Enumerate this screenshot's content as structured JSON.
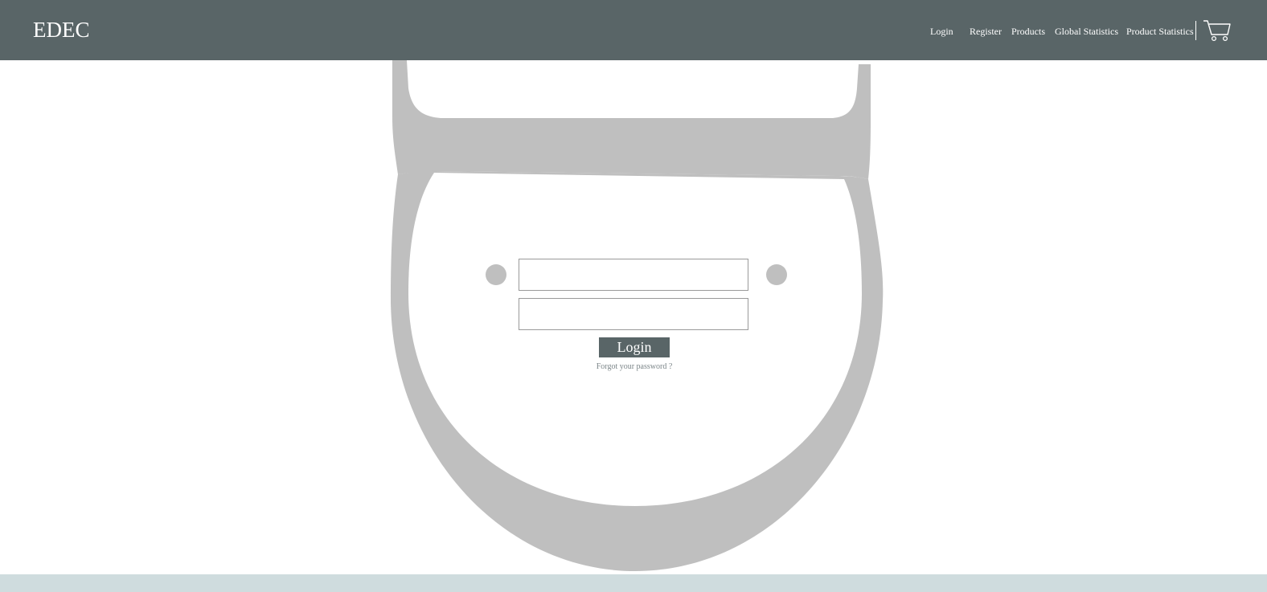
{
  "header": {
    "brand": "EDEC",
    "nav": [
      {
        "label": "Login"
      },
      {
        "label": "Register"
      },
      {
        "label": "Products"
      },
      {
        "label": "Global Statistics"
      },
      {
        "label": "Product Statistics"
      }
    ],
    "cart_icon": "shopping-cart-icon"
  },
  "login_form": {
    "username_value": "",
    "password_value": "",
    "button_label": "Login",
    "forgot_label": "Forgot your password ?"
  },
  "colors": {
    "header_bg": "#596567",
    "button_bg": "#596567",
    "footer_bg": "#cfdcde",
    "logo_gray": "#bfbfbf"
  }
}
